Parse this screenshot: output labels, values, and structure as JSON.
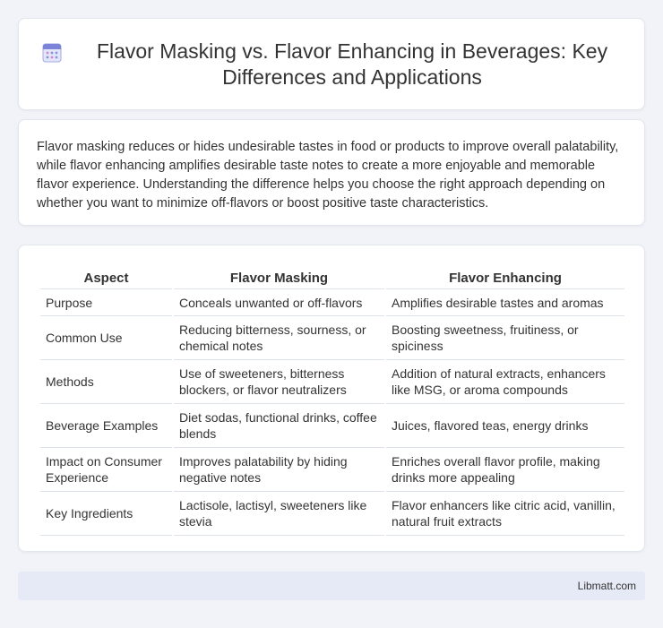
{
  "header": {
    "icon": "document-icon",
    "title": "Flavor Masking vs. Flavor Enhancing in Beverages: Key Differences and Applications"
  },
  "intro": {
    "text": "Flavor masking reduces or hides undesirable tastes in food or products to improve overall palatability, while flavor enhancing amplifies desirable taste notes to create a more enjoyable and memorable flavor experience. Understanding the difference helps you choose the right approach depending on whether you want to minimize off-flavors or boost positive taste characteristics."
  },
  "table": {
    "headers": [
      "Aspect",
      "Flavor Masking",
      "Flavor Enhancing"
    ],
    "rows": [
      [
        "Purpose",
        "Conceals unwanted or off-flavors",
        "Amplifies desirable tastes and aromas"
      ],
      [
        "Common Use",
        "Reducing bitterness, sourness, or chemical notes",
        "Boosting sweetness, fruitiness, or spiciness"
      ],
      [
        "Methods",
        "Use of sweeteners, bitterness blockers, or flavor neutralizers",
        "Addition of natural extracts, enhancers like MSG, or aroma compounds"
      ],
      [
        "Beverage Examples",
        "Diet sodas, functional drinks, coffee blends",
        "Juices, flavored teas, energy drinks"
      ],
      [
        "Impact on Consumer Experience",
        "Improves palatability by hiding negative notes",
        "Enriches overall flavor profile, making drinks more appealing"
      ],
      [
        "Key Ingredients",
        "Lactisole, lactisyl, sweeteners like stevia",
        "Flavor enhancers like citric acid, vanillin, natural fruit extracts"
      ]
    ]
  },
  "footer": {
    "source": "Libmatt.com"
  },
  "colors": {
    "background": "#f1f3f8",
    "card": "#ffffff",
    "footer": "#e6eaf6",
    "icon_accent": "#7b84d6"
  }
}
